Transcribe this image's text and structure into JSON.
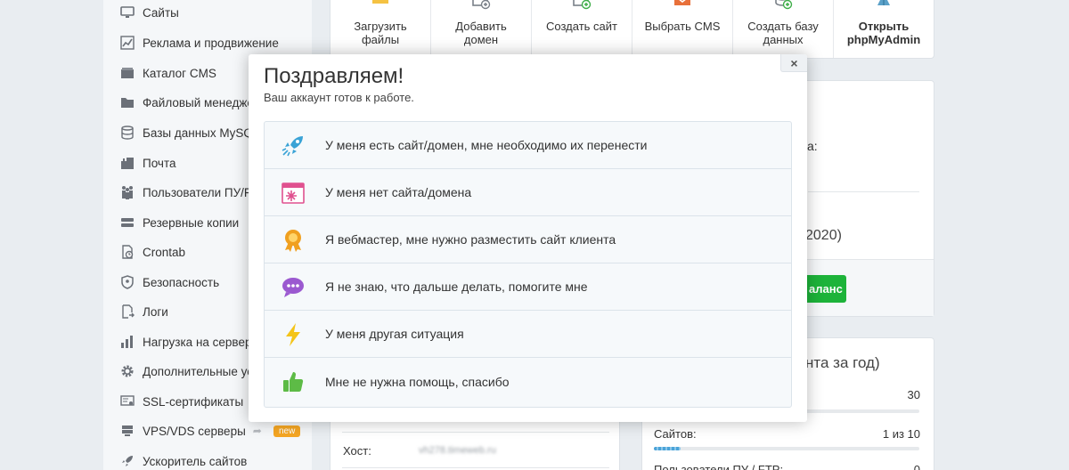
{
  "sidebar": {
    "items": [
      {
        "label": "Сайты",
        "icon": "monitor-icon"
      },
      {
        "label": "Реклама и продвижение",
        "icon": "chart-icon"
      },
      {
        "label": "Каталог CMS",
        "icon": "box-icon"
      },
      {
        "label": "Файловый менеджер",
        "icon": "folder-icon"
      },
      {
        "label": "Базы данных MySQL",
        "icon": "database-icon"
      },
      {
        "label": "Почта",
        "icon": "mailbox-icon"
      },
      {
        "label": "Пользователи ПУ/FTP",
        "icon": "users-icon"
      },
      {
        "label": "Резервные копии",
        "icon": "drive-icon"
      },
      {
        "label": "Crontab",
        "icon": "clock-icon"
      },
      {
        "label": "Безопасность",
        "icon": "shield-icon"
      },
      {
        "label": "Логи",
        "icon": "log-icon"
      },
      {
        "label": "Нагрузка на сервер",
        "icon": "bars-icon"
      },
      {
        "label": "Дополнительные услуги",
        "icon": "gear-icon"
      },
      {
        "label": "SSL-сертификаты",
        "icon": "certificate-icon"
      },
      {
        "label": "VPS/VDS серверы",
        "icon": "cloud-icon",
        "badge": "new"
      },
      {
        "label": "Ускоритель сайтов",
        "icon": "rocket-icon"
      }
    ]
  },
  "toolbar": {
    "items": [
      {
        "line1": "Загрузить",
        "line2": "файлы",
        "icon": "folder-icon"
      },
      {
        "line1": "Добавить",
        "line2": "домен",
        "icon": "add-domain-icon"
      },
      {
        "line1": "Создать сайт",
        "line2": "",
        "icon": "add-site-icon"
      },
      {
        "line1": "Выбрать CMS",
        "line2": "",
        "icon": "cms-box-icon"
      },
      {
        "line1": "Создать базу",
        "line2": "данных",
        "icon": "add-database-icon"
      },
      {
        "line1": "Открыть",
        "line2": "phpMyAdmin",
        "icon": "phpmyadmin-sail-icon"
      }
    ]
  },
  "background": {
    "colon_fragment": "а:",
    "year_fragment": "2020)",
    "balance_button": "аланс",
    "stats_title": "нта за год)",
    "stat_first_value": "30",
    "sites_label": "Сайтов:",
    "sites_value": "1 из 10",
    "sites_fraction": 0.1,
    "users_label": "Пользователи ПУ / FTP:",
    "users_value": "0",
    "host_label": "Хост:",
    "host_value": "vh278.timeweb.ru"
  },
  "modal": {
    "title": "Поздравляем!",
    "subtitle": "Ваш аккаунт готов к работе.",
    "close_label": "×",
    "options": [
      {
        "text": "У меня есть сайт/домен, мне необходимо их перенести",
        "icon": "rocket-icon"
      },
      {
        "text": "У меня нет сайта/домена",
        "icon": "browser-window-icon"
      },
      {
        "text": "Я вебмастер, мне нужно разместить сайт клиента",
        "icon": "award-medal-icon"
      },
      {
        "text": "Я не знаю, что дальше делать, помогите мне",
        "icon": "chat-bubble-icon"
      },
      {
        "text": "У меня другая ситуация",
        "icon": "lightning-icon"
      },
      {
        "text": "Мне не нужна помощь, спасибо",
        "icon": "thumbs-up-icon"
      }
    ]
  },
  "colors": {
    "accent_blue": "#2aa5d8",
    "rocket": "#3aa3d6",
    "browser": "#e0518f",
    "medal": "#f0a020",
    "chat": "#9b59d0",
    "lightning": "#f4c418",
    "thumb": "#5dbb46",
    "balance_green": "#1db33a"
  }
}
